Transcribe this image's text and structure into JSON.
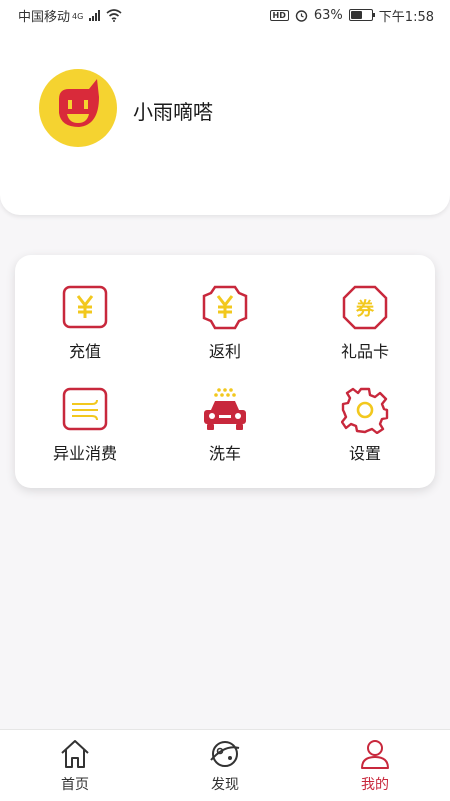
{
  "status_bar": {
    "carrier": "中国移动",
    "network": "4G",
    "battery_text": "63%",
    "battery_level": 0.63,
    "hd_badge": "HD",
    "time": "下午1:58"
  },
  "profile": {
    "username": "小雨嘀嗒"
  },
  "menu": {
    "items": [
      {
        "label": "充值",
        "icon": "yuan-square-icon"
      },
      {
        "label": "返利",
        "icon": "yuan-badge-icon"
      },
      {
        "label": "礼品卡",
        "icon": "coupon-icon"
      },
      {
        "label": "异业消费",
        "icon": "wind-card-icon"
      },
      {
        "label": "洗车",
        "icon": "car-wash-icon"
      },
      {
        "label": "设置",
        "icon": "gear-icon"
      }
    ]
  },
  "tabs": [
    {
      "label": "首页",
      "icon": "home-icon",
      "active": false
    },
    {
      "label": "发现",
      "icon": "planet-icon",
      "active": false
    },
    {
      "label": "我的",
      "icon": "user-icon",
      "active": true
    }
  ],
  "colors": {
    "accent_red": "#c8283c",
    "accent_yellow": "#f2c81e",
    "avatar_bg": "#f5d330"
  }
}
